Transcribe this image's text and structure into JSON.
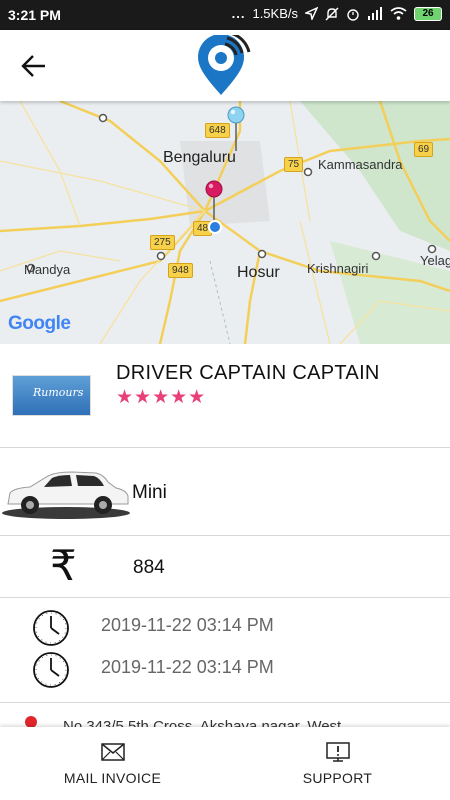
{
  "status_bar": {
    "time": "3:21 PM",
    "dots": "...",
    "network_speed": "1.5KB/s",
    "battery_level": "26"
  },
  "header": {
    "back_icon": "arrow-left-icon",
    "logo_icon": "location-signal-logo-icon"
  },
  "map": {
    "labels": {
      "bengaluru": "Bengaluru",
      "kammasandra": "Kammasandra",
      "mandya": "Mandya",
      "hosur": "Hosur",
      "krishnagiri": "Krishnagiri",
      "yelag": "Yelag"
    },
    "shields": [
      "648",
      "75",
      "69",
      "275",
      "48",
      "948"
    ],
    "attribution": "Google",
    "colors": {
      "road": "#f3cf5a",
      "land": "#e9eef0",
      "pickup_pin": "#8fd3f2",
      "drop_pin": "#d81b60"
    }
  },
  "driver": {
    "name": "DRIVER CAPTAIN CAPTAIN",
    "rating_stars": "★★★★★",
    "rating": 5,
    "photo_text": "Rumours"
  },
  "vehicle": {
    "type": "Mini",
    "icon": "car-icon"
  },
  "fare": {
    "currency_symbol": "₹",
    "amount": "884"
  },
  "times": {
    "pickup_time": "2019-11-22 03:14 PM",
    "drop_time": "2019-11-22 03:14 PM"
  },
  "address": {
    "text": "No.343/5 5th Cross, Akshaya nagar, West"
  },
  "bottom_bar": {
    "mail_invoice_label": "MAIL INVOICE",
    "support_label": "SUPPORT"
  }
}
